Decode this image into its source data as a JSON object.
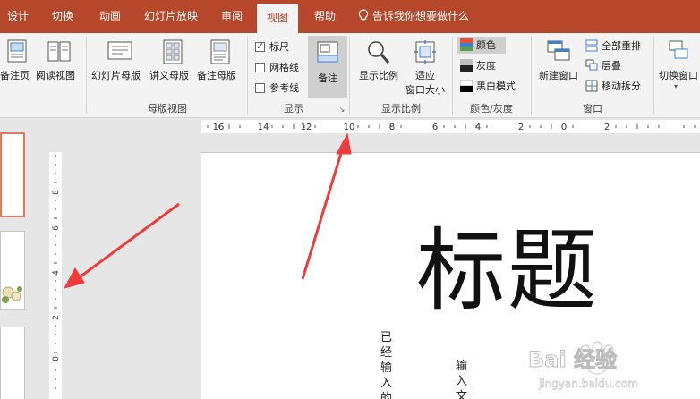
{
  "tabs": [
    {
      "label": "设计"
    },
    {
      "label": "切换"
    },
    {
      "label": "动画"
    },
    {
      "label": "幻灯片放映"
    },
    {
      "label": "审阅"
    },
    {
      "label": "视图"
    },
    {
      "label": "帮助"
    }
  ],
  "tell_me": "告诉我你想要做什么",
  "ribbon": {
    "views": [
      {
        "label": "备注页"
      },
      {
        "label": "阅读视图"
      }
    ],
    "master_views": {
      "buttons": [
        {
          "label": "幻灯片母版"
        },
        {
          "label": "讲义母版"
        },
        {
          "label": "备注母版"
        }
      ],
      "group_label": "母版视图"
    },
    "show": {
      "ruler": "标尺",
      "gridlines": "网格线",
      "guides": "参考线",
      "notes": "备注",
      "group_label": "显示"
    },
    "zoom": {
      "zoom_label": "显示比例",
      "fit_line1": "适应",
      "fit_line2": "窗口大小",
      "group_label": "显示比例"
    },
    "color": {
      "color": "颜色",
      "grayscale": "灰度",
      "bw": "黑白模式",
      "group_label": "颜色/灰度",
      "colors": {
        "red": "#e8502f",
        "blue": "#3f7fd0",
        "green": "#52a447"
      }
    },
    "window": {
      "new_window": "新建窗口",
      "arrange_all": "全部重排",
      "cascade": "层叠",
      "move_split": "移动拆分",
      "group_label": "窗口"
    },
    "switch_window": "切换窗口"
  },
  "rulers": {
    "h_labels": [
      "16",
      "14",
      "12",
      "10",
      "8",
      "6",
      "4",
      "2",
      "0",
      "2"
    ],
    "v_labels": [
      "8",
      "6",
      "4",
      "2",
      "0"
    ]
  },
  "slide": {
    "title": "标题",
    "text1": "已经输入的",
    "text2": "输入文"
  },
  "watermark": {
    "brand": "Bai 经验",
    "url": "jingyan.baidu.com"
  },
  "theme": {
    "accent": "#b7472a",
    "ribbon_bg": "#f3f3f3",
    "arrow": "#ee3b3b"
  }
}
